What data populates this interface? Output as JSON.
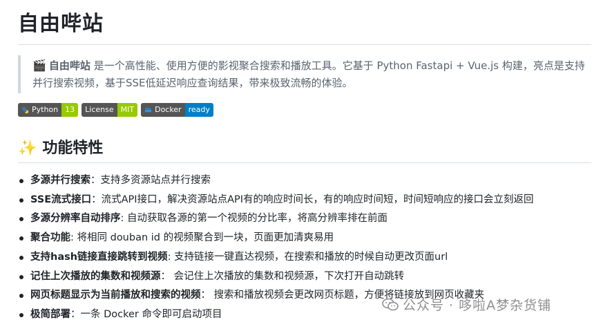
{
  "title": "自由哔站",
  "intro": {
    "emoji": "🎬",
    "name": "自由哔站",
    "text": " 是一个高性能、使用方便的影视聚合搜索和播放工具。它基于 Python Fastapi + Vue.js 构建，亮点是支持并行搜索视频，基于SSE低延迟响应查询结果，带来极致流畅的体验。"
  },
  "badges": [
    {
      "label": "Python",
      "value": "13",
      "color": "#97ca00",
      "icon": "python-icon"
    },
    {
      "label": "License",
      "value": "MIT",
      "color": "#97ca00"
    },
    {
      "label": "Docker",
      "value": "ready",
      "color": "#007ec6",
      "icon": "docker-icon"
    }
  ],
  "section": {
    "emoji": "✨",
    "title": "功能特性"
  },
  "features": [
    {
      "name": "多源并行搜索",
      "sep": "：",
      "desc": "支持多资源站点并行搜索"
    },
    {
      "name": "SSE流式接口",
      "sep": "：",
      "desc": "流式API接口，解决资源站点API有的响应时间长，有的响应时间短，时间短响应的接口会立刻返回"
    },
    {
      "name": "多源分辨率自动排序",
      "sep": ": ",
      "desc": "自动获取各源的第一个视频的分比率，将高分辨率排在前面"
    },
    {
      "name": "聚合功能",
      "sep": ": ",
      "desc": "将相同 douban id 的视频聚合到一块，页面更加清爽易用"
    },
    {
      "name": "支持hash链接直接跳转到视频",
      "sep": ": ",
      "desc": "支持链接一键直达视频，在搜索和播放的时候自动更改页面url"
    },
    {
      "name": "记住上次播放的集数和视频源",
      "sep": "： ",
      "desc": "会记住上次播放的集数和视频源，下次打开自动跳转"
    },
    {
      "name": "网页标题显示为当前播放和搜索的视频",
      "sep": "： ",
      "desc": "搜索和播放视频会更改网页标题，方便将链接放到网页收藏夹"
    },
    {
      "name": "极简部署",
      "sep": "：",
      "desc": "一条 Docker 命令即可启动项目"
    }
  ],
  "watermark": "公众号 · 哆啦A梦杂货铺"
}
